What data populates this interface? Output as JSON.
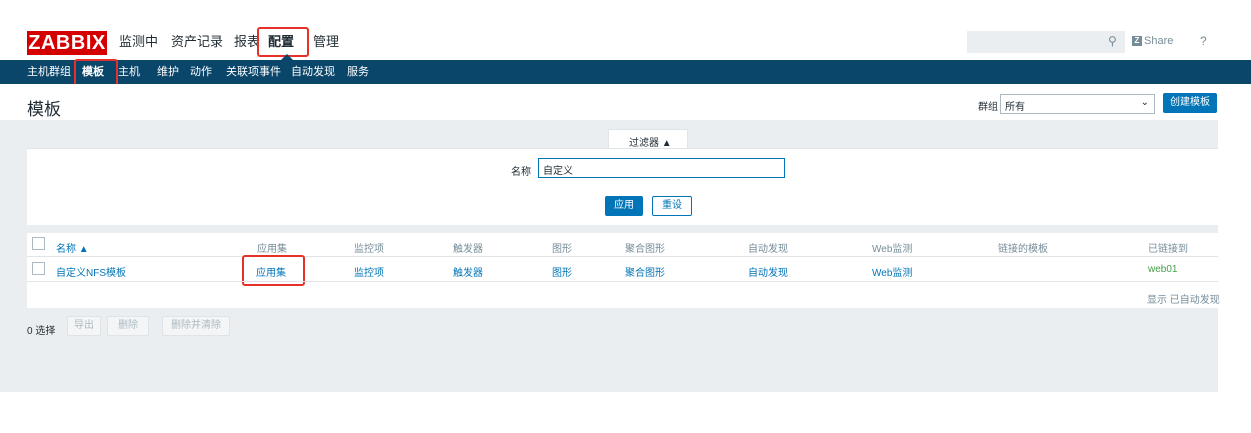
{
  "header": {
    "logo": "ZABBIX",
    "menu": [
      "监测中",
      "资产记录",
      "报表",
      "配置",
      "管理"
    ],
    "share": "Share",
    "help": "?"
  },
  "nav": {
    "items": [
      "主机群组",
      "模板",
      "主机",
      "维护",
      "动作",
      "关联项事件",
      "自动发现",
      "服务"
    ]
  },
  "page": {
    "title": "模板",
    "group_label": "群组",
    "group_value": "所有",
    "create_button": "创建模板"
  },
  "filter": {
    "tab_label": "过滤器 ▲",
    "name_label": "名称",
    "name_value": "自定义",
    "apply": "应用",
    "reset": "重设"
  },
  "table": {
    "headers": [
      "名称 ▲",
      "应用集",
      "监控项",
      "触发器",
      "图形",
      "聚合图形",
      "自动发现",
      "Web监测",
      "链接的模板",
      "已链接到"
    ],
    "row": {
      "name": "自定义NFS模板",
      "applications": "应用集",
      "items": "监控项",
      "triggers": "触发器",
      "graphs": "图形",
      "screens": "聚合图形",
      "discovery": "自动发现",
      "web": "Web监测",
      "linked_to": "web01"
    },
    "footer_note": "显示 已自动发现"
  },
  "actions": {
    "selected": "0 选择",
    "export": "导出",
    "delete": "删除",
    "delete_clear": "删除并清除"
  },
  "colors": {
    "brand": "#d40000",
    "nav": "#0a466a",
    "link": "#0275b8",
    "highlight": "#e8302a"
  }
}
